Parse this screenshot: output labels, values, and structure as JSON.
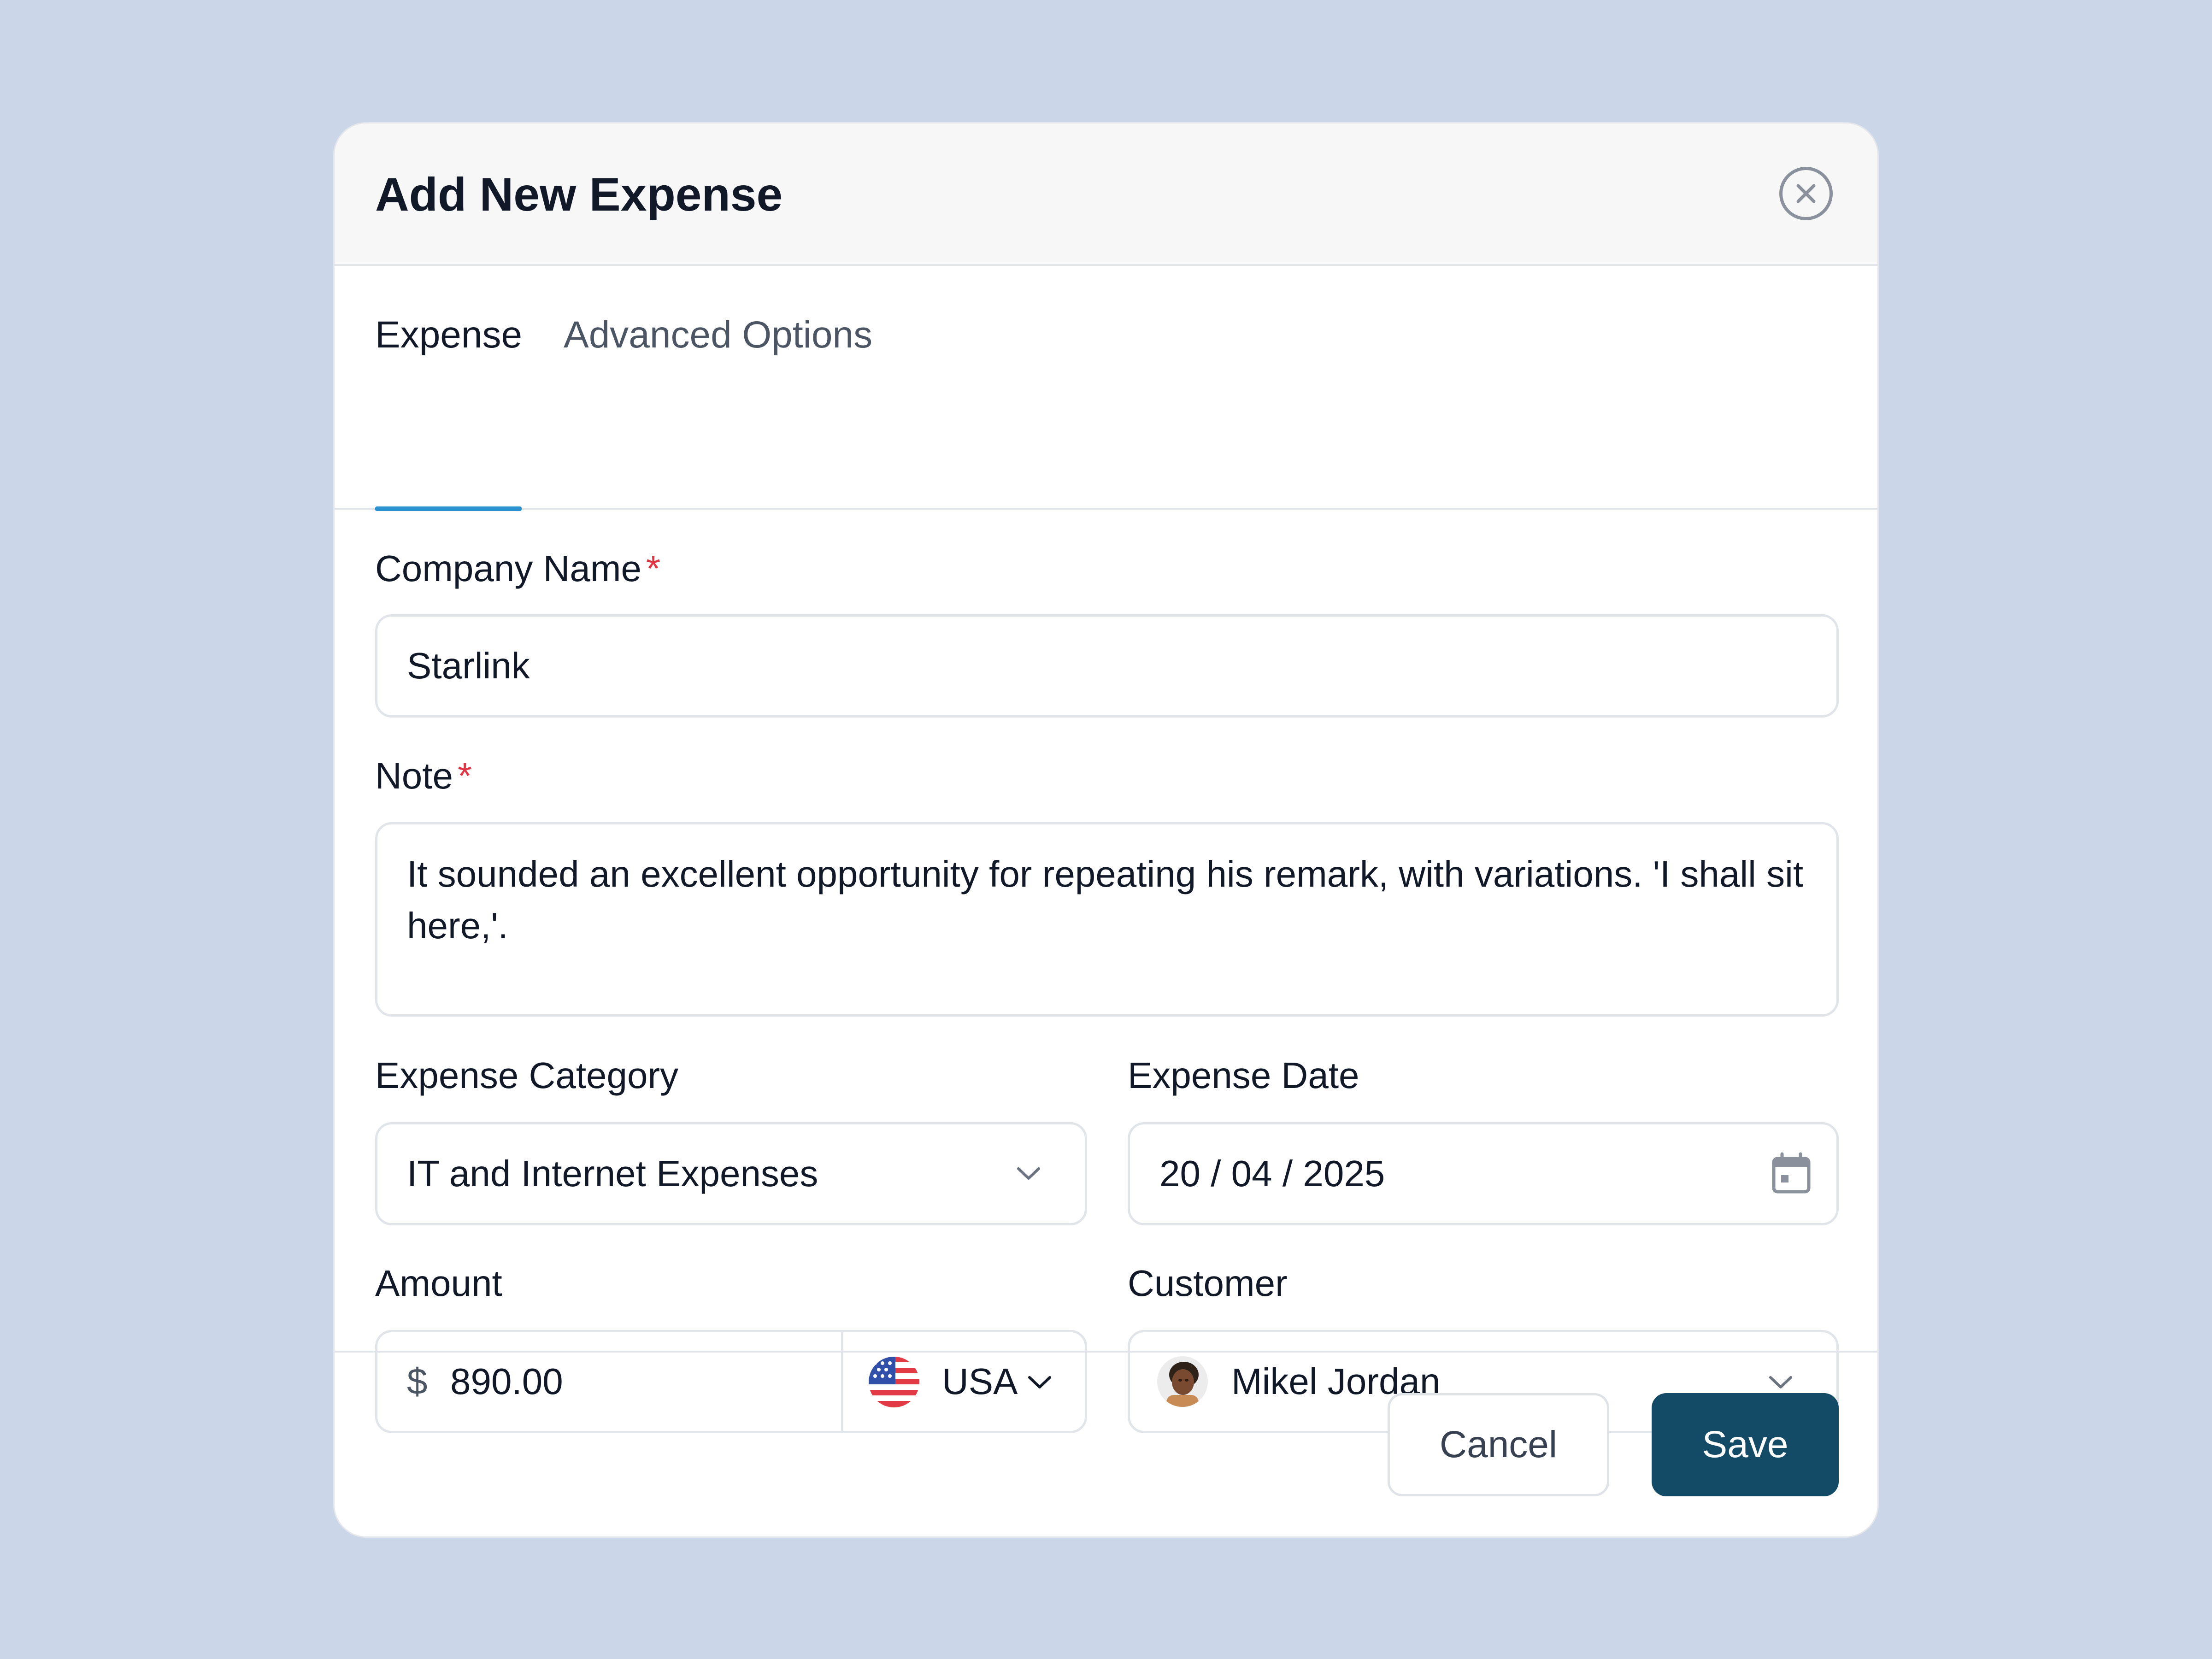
{
  "modal": {
    "title": "Add New Expense"
  },
  "tabs": [
    {
      "label": "Expense",
      "active": true
    },
    {
      "label": "Advanced Options",
      "active": false
    }
  ],
  "form": {
    "company_name": {
      "label": "Company Name",
      "required_mark": "*",
      "value": "Starlink"
    },
    "note": {
      "label": "Note",
      "required_mark": "*",
      "value": "It sounded an excellent opportunity for repeating his remark, with variations. 'I shall sit here,'."
    },
    "expense_category": {
      "label": "Expense Category",
      "value": "IT and Internet Expenses"
    },
    "expense_date": {
      "label": "Expense Date",
      "value": "20 / 04 / 2025"
    },
    "amount": {
      "label": "Amount",
      "currency_symbol": "$",
      "value": "890.00",
      "currency": "USA"
    },
    "customer": {
      "label": "Customer",
      "value": "Mikel Jordan"
    }
  },
  "footer": {
    "cancel_label": "Cancel",
    "save_label": "Save"
  },
  "colors": {
    "background": "#cbd6e8",
    "accent_tab": "#2b93d1",
    "primary_button": "#134b66",
    "required": "#e03545"
  },
  "icons": [
    "close-icon",
    "chevron-down-icon",
    "calendar-icon",
    "us-flag-icon",
    "avatar"
  ]
}
